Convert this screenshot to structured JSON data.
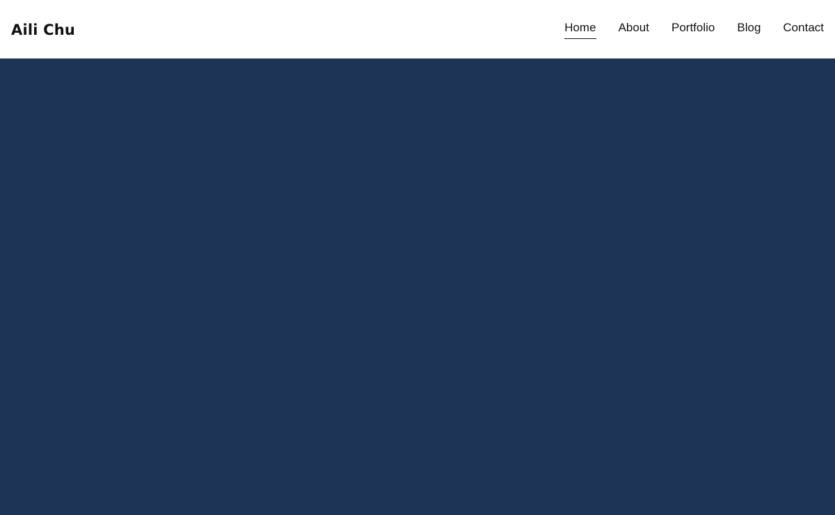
{
  "site": {
    "brand": "Aili Chu"
  },
  "nav": {
    "items": [
      {
        "label": "Home",
        "active": true
      },
      {
        "label": "About",
        "active": false
      },
      {
        "label": "Portfolio",
        "active": false
      },
      {
        "label": "Blog",
        "active": false
      },
      {
        "label": "Contact",
        "active": false
      }
    ]
  },
  "colors": {
    "header_bg": "#ffffff",
    "hero_bg": "#1e3457",
    "text": "#111111"
  }
}
